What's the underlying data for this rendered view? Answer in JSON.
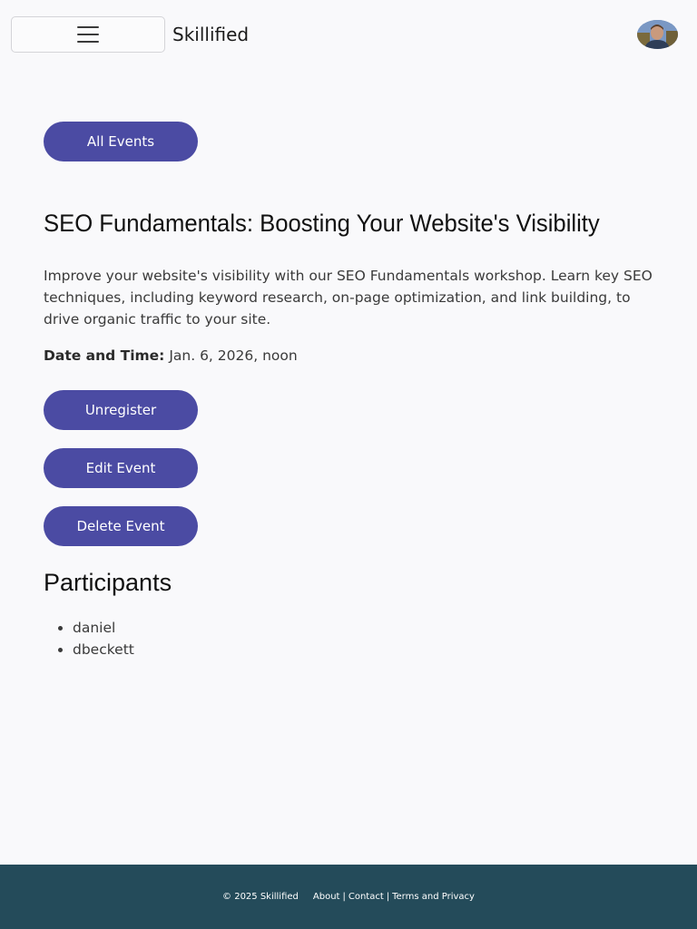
{
  "header": {
    "brand": "Skillified",
    "menu_icon": "hamburger-icon",
    "avatar_icon": "user-avatar"
  },
  "main": {
    "all_events_label": "All Events",
    "event": {
      "title": "SEO Fundamentals: Boosting Your Website's Visibility",
      "description": "Improve your website's visibility with our SEO Fundamentals workshop. Learn key SEO techniques, including keyword research, on-page optimization, and link building, to drive organic traffic to your site.",
      "datetime_label": "Date and Time:",
      "datetime_value": "Jan. 6, 2026, noon"
    },
    "actions": {
      "unregister_label": "Unregister",
      "edit_label": "Edit Event",
      "delete_label": "Delete Event"
    },
    "participants_heading": "Participants",
    "participants": [
      "daniel",
      "dbeckett"
    ]
  },
  "footer": {
    "copyright": "© 2025 Skillified",
    "links": {
      "about": "About",
      "contact": "Contact",
      "terms": "Terms and Privacy"
    },
    "separator": "|"
  },
  "colors": {
    "accent": "#4b4ba3",
    "footer_bg": "#244b5a",
    "page_bg": "#f9f9fb"
  }
}
